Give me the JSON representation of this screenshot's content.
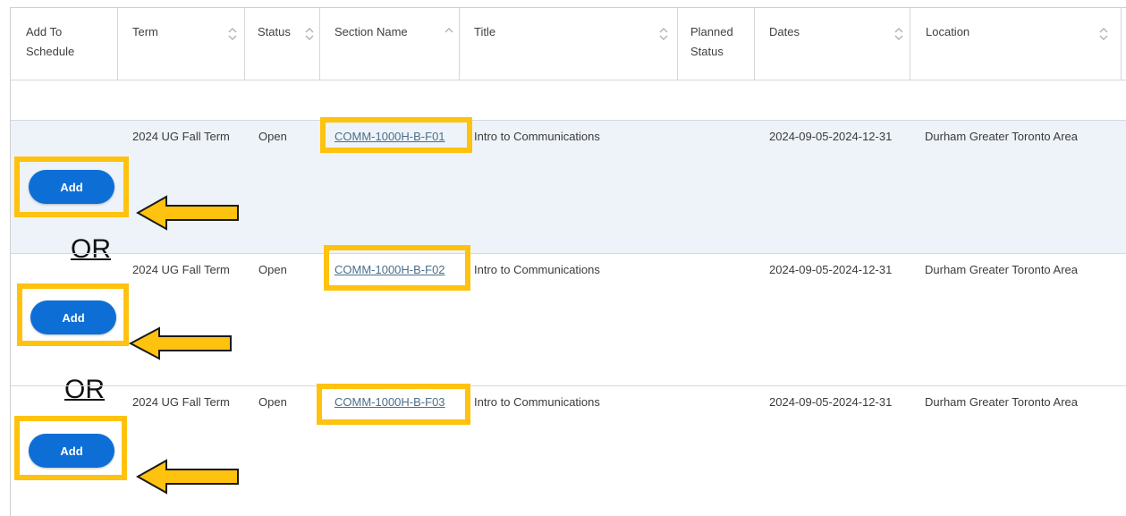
{
  "columns": [
    {
      "key": "add",
      "label": "Add To\nSchedule"
    },
    {
      "key": "term",
      "label": "Term"
    },
    {
      "key": "status",
      "label": "Status"
    },
    {
      "key": "section",
      "label": "Section Name"
    },
    {
      "key": "title",
      "label": "Title"
    },
    {
      "key": "planned",
      "label": "Planned\nStatus"
    },
    {
      "key": "dates",
      "label": "Dates"
    },
    {
      "key": "location",
      "label": "Location"
    }
  ],
  "rows": [
    {
      "term": "2024 UG Fall Term",
      "status": "Open",
      "section": "COMM-1000H-B-F01",
      "title": "Intro to Communications",
      "planned": "",
      "dates": "2024-09-05-2024-12-31",
      "location": "Durham Greater Toronto Area",
      "add_label": "Add"
    },
    {
      "term": "2024 UG Fall Term",
      "status": "Open",
      "section": "COMM-1000H-B-F02",
      "title": "Intro to Communications",
      "planned": "",
      "dates": "2024-09-05-2024-12-31",
      "location": "Durham Greater Toronto Area",
      "add_label": "Add"
    },
    {
      "term": "2024 UG Fall Term",
      "status": "Open",
      "section": "COMM-1000H-B-F03",
      "title": "Intro to Communications",
      "planned": "",
      "dates": "2024-09-05-2024-12-31",
      "location": "Durham Greater Toronto Area",
      "add_label": "Add"
    }
  ],
  "annotations": {
    "or_1": "OR",
    "or_2": "OR",
    "highlight_color": "#ffc20e",
    "arrow_direction": "left"
  },
  "colors": {
    "button": "#0d6fd6",
    "link": "#4a6f8a",
    "row_shaded": "#eef3f9"
  }
}
